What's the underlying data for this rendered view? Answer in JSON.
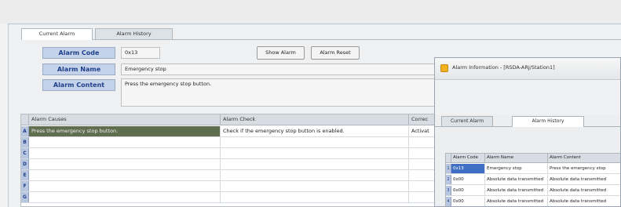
{
  "tabs": [
    {
      "label": "Current Alarm",
      "active": true
    },
    {
      "label": "Alarm History",
      "active": false
    }
  ],
  "form": {
    "code_label": "Alarm Code",
    "code_value": "0x13",
    "name_label": "Alarm Name",
    "name_value": "Emergency stop",
    "content_label": "Alarm Content",
    "content_value": "Press the emergency stop button.",
    "show_button": "Show Alarm",
    "reset_button": "Alarm Reset"
  },
  "grid": {
    "columns": [
      "Alarm Causes",
      "Alarm Check",
      "Correc"
    ],
    "rows": [
      {
        "num": "A",
        "cells": [
          "Press the emergency stop button.",
          "Check if the emergency stop button is enabled.",
          "Activat"
        ]
      },
      {
        "num": "B",
        "cells": [
          "",
          "",
          ""
        ]
      },
      {
        "num": "C",
        "cells": [
          "",
          "",
          ""
        ]
      },
      {
        "num": "D",
        "cells": [
          "",
          "",
          ""
        ]
      },
      {
        "num": "E",
        "cells": [
          "",
          "",
          ""
        ]
      },
      {
        "num": "F",
        "cells": [
          "",
          "",
          ""
        ]
      },
      {
        "num": "G",
        "cells": [
          "",
          "",
          ""
        ]
      }
    ]
  },
  "popup": {
    "title": "Alarm Information - [RSDA-ARJ/Station1]",
    "tabs": [
      {
        "label": "Current Alarm",
        "active": false
      },
      {
        "label": "Alarm History",
        "active": true
      }
    ],
    "columns": [
      "Alarm Code",
      "Alarm Name",
      "Alarm Content"
    ],
    "rows": [
      {
        "num": "1",
        "cells": [
          "0x13",
          "Emergency stop",
          "Press the emergency stop"
        ]
      },
      {
        "num": "2",
        "cells": [
          "0x00",
          "Absolute data transmitted",
          "Absolute data transmitted"
        ]
      },
      {
        "num": "3",
        "cells": [
          "0x00",
          "Absolute data transmitted",
          "Absolute data transmitted"
        ]
      },
      {
        "num": "4",
        "cells": [
          "0x00",
          "Absolute data transmitted",
          "Absolute data transmitted"
        ]
      }
    ]
  }
}
